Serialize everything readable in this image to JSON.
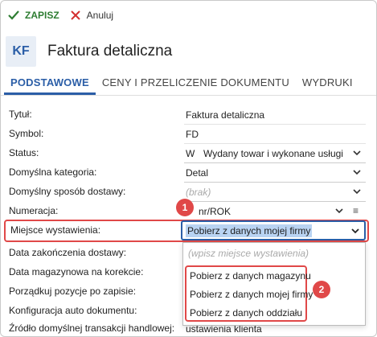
{
  "toolbar": {
    "save_label": "ZAPISZ",
    "cancel_label": "Anuluj"
  },
  "header": {
    "avatar": "KF",
    "title": "Faktura detaliczna"
  },
  "tabs": [
    {
      "label": "PODSTAWOWE",
      "active": true
    },
    {
      "label": "CENY I PRZELICZENIE DOKUMENTU",
      "active": false
    },
    {
      "label": "WYDRUKI",
      "active": false
    }
  ],
  "form": {
    "tytul": {
      "label": "Tytuł:",
      "value": "Faktura detaliczna"
    },
    "symbol": {
      "label": "Symbol:",
      "value": "FD"
    },
    "status": {
      "label": "Status:",
      "code": "W",
      "value": "Wydany towar i wykonane usługi"
    },
    "kategoria": {
      "label": "Domyślna kategoria:",
      "value": "Detal"
    },
    "dostawa": {
      "label": "Domyślny sposób dostawy:",
      "placeholder": "(brak)"
    },
    "numeracja": {
      "label": "Numeracja:",
      "value": "nr/ROK"
    },
    "miejsce": {
      "label": "Miejsce wystawienia:",
      "value": "Pobierz z danych mojej firmy"
    },
    "data_zak": {
      "label": "Data zakończenia dostawy:"
    },
    "data_mag": {
      "label": "Data magazynowa na korekcie:"
    },
    "porzadkuj": {
      "label": "Porządkuj pozycje po zapisie:"
    },
    "konfig": {
      "label": "Konfiguracja auto dokumentu:"
    },
    "zrodlo": {
      "label": "Źródło domyślnej transakcji handlowej:",
      "value": "ustawienia klienta"
    }
  },
  "dropdown": {
    "placeholder": "(wpisz miejsce wystawienia)",
    "options": [
      "Pobierz z danych magazynu",
      "Pobierz z danych mojej firmy",
      "Pobierz z danych oddziału"
    ]
  },
  "badges": {
    "one": "1",
    "two": "2"
  },
  "colors": {
    "accent": "#2b5ea7",
    "save": "#2e7d32",
    "cancel": "#d32f2f",
    "highlight": "#e04848"
  }
}
